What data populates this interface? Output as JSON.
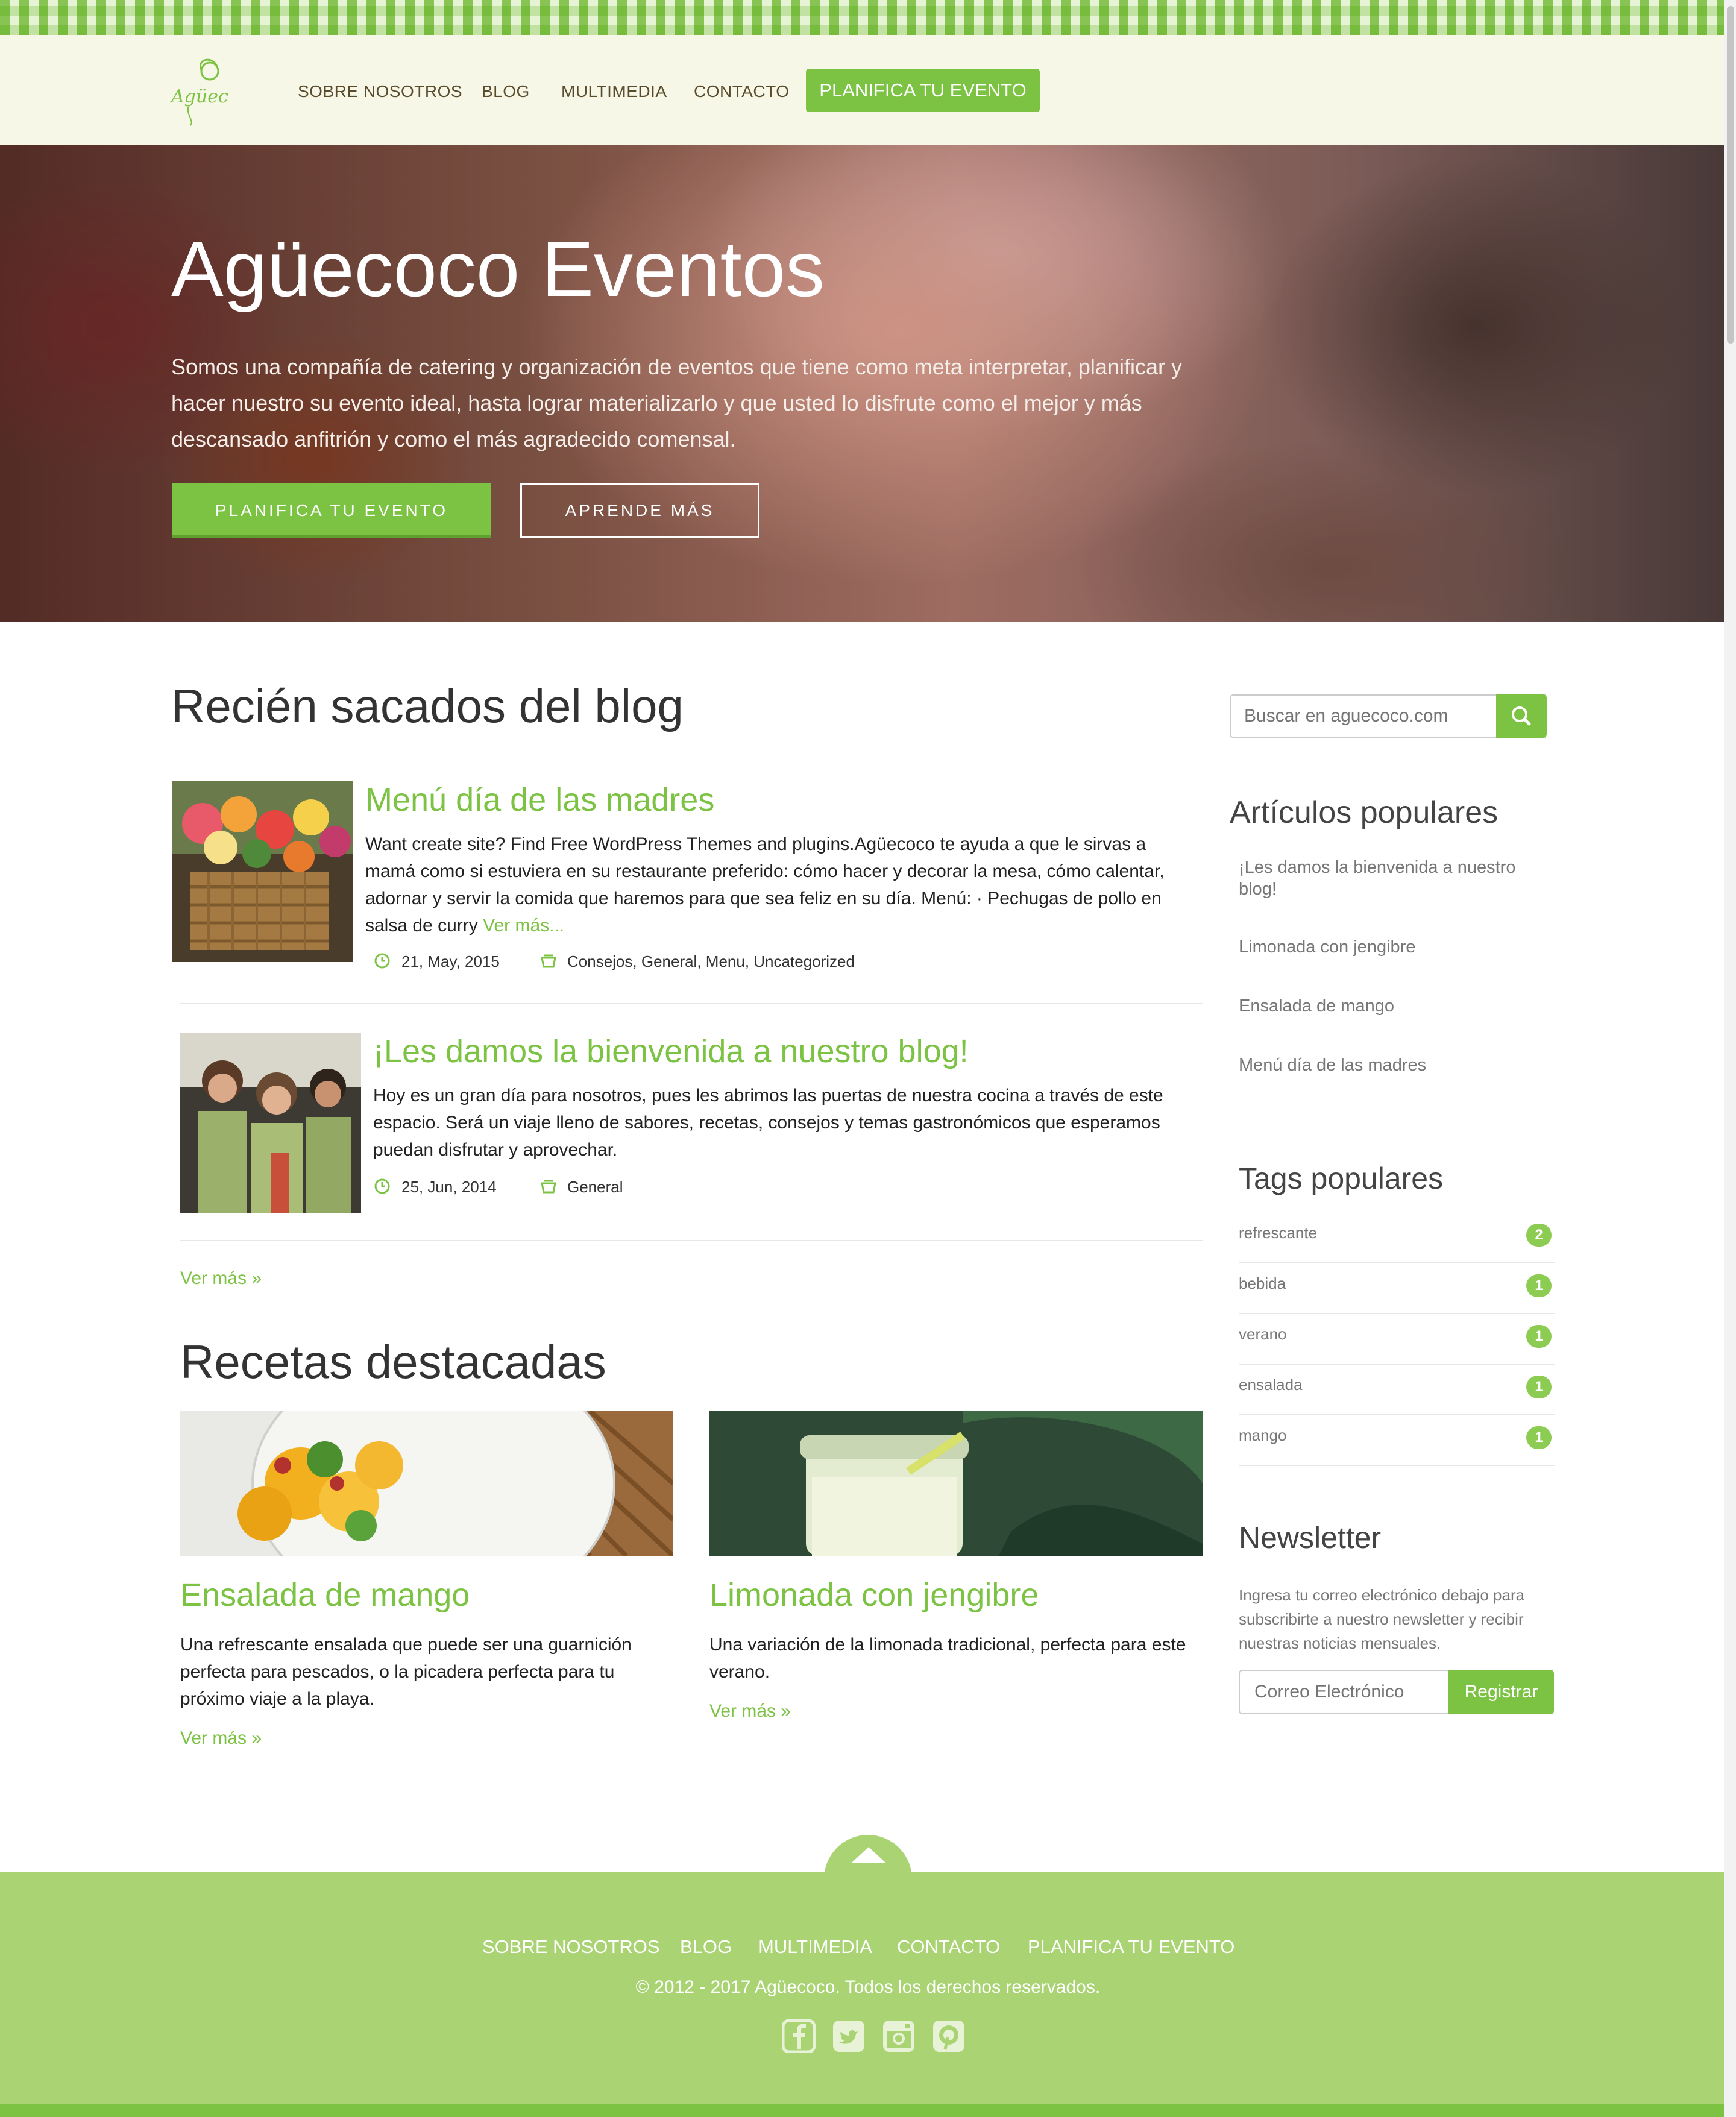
{
  "brand": {
    "accent": "#7cc243",
    "footer_bg": "#aad474",
    "header_bg": "#f6f7e6"
  },
  "header": {
    "logo_alt": "Agüecoco",
    "nav": [
      "SOBRE NOSOTROS",
      "BLOG",
      "MULTIMEDIA",
      "CONTACTO"
    ],
    "cta": "PLANIFICA TU EVENTO"
  },
  "hero": {
    "title": "Agüecoco Eventos",
    "text": "Somos una compañía de catering y organización de eventos que tiene como meta interpretar, planificar y hacer nuestro su evento ideal, hasta lograr materializarlo y que usted lo disfrute como el mejor y más descansado anfitrión y como el más agradecido comensal.",
    "primary_button": "PLANIFICA TU EVENTO",
    "secondary_button": "APRENDE MÁS"
  },
  "blog": {
    "title": "Recién sacados del blog",
    "posts": [
      {
        "title": "Menú día de las madres",
        "excerpt": "Want create site? Find Free WordPress Themes and plugins.Agüecoco te ayuda a que le sirvas a mamá como si estuviera en su restaurante preferido: cómo hacer y decorar la mesa, cómo calentar, adornar y servir la comida que haremos para que sea feliz en su día. Menú: · Pechugas de pollo en salsa de curry",
        "more": "Ver más...",
        "date": "21, May, 2015",
        "categories": "Consejos, General, Menu, Uncategorized",
        "image_icon": "flower-basket-photo"
      },
      {
        "title": "¡Les damos la bienvenida a nuestro blog!",
        "excerpt": "Hoy es un gran día para nosotros, pues les abrimos las puertas de nuestra cocina a través de este espacio. Será un viaje lleno de sabores, recetas, consejos y temas gastronómicos que esperamos puedan disfrutar y aprovechar.",
        "more": "",
        "date": "25, Jun, 2014",
        "categories": "General",
        "image_icon": "team-photo"
      }
    ],
    "see_more": "Ver más »"
  },
  "recipes": {
    "title": "Recetas destacadas",
    "items": [
      {
        "title": "Ensalada de mango",
        "text": "Una refrescante ensalada que puede ser una guarnición perfecta para pescados, o la picadera perfecta para tu próximo viaje a la playa.",
        "more": "Ver más »"
      },
      {
        "title": "Limonada con jengibre",
        "text": "Una variación de la limonada tradicional, perfecta para este verano.",
        "more": "Ver más »"
      }
    ]
  },
  "sidebar": {
    "search_placeholder": "Buscar en aguecoco.com",
    "popular_title": "Artículos populares",
    "popular": [
      "¡Les damos la bienvenida a nuestro blog!",
      "Limonada con jengibre",
      "Ensalada de mango",
      "Menú día de las madres"
    ],
    "tags_title": "Tags populares",
    "tags": [
      {
        "name": "refrescante",
        "count": "2"
      },
      {
        "name": "bebida",
        "count": "1"
      },
      {
        "name": "verano",
        "count": "1"
      },
      {
        "name": "ensalada",
        "count": "1"
      },
      {
        "name": "mango",
        "count": "1"
      }
    ],
    "newsletter_title": "Newsletter",
    "newsletter_text": "Ingresa tu correo electrónico debajo para subscribirte a nuestro newsletter y recibir nuestras noticias mensuales.",
    "newsletter_placeholder": "Correo Electrónico",
    "newsletter_button": "Registrar"
  },
  "footer": {
    "nav": [
      "SOBRE NOSOTROS",
      "BLOG",
      "MULTIMEDIA",
      "CONTACTO",
      "PLANIFICA TU EVENTO"
    ],
    "copyright": "© 2012 - 2017 Agüecoco. Todos los derechos reservados.",
    "social": [
      "facebook-icon",
      "twitter-icon",
      "instagram-icon",
      "pinterest-icon"
    ]
  }
}
